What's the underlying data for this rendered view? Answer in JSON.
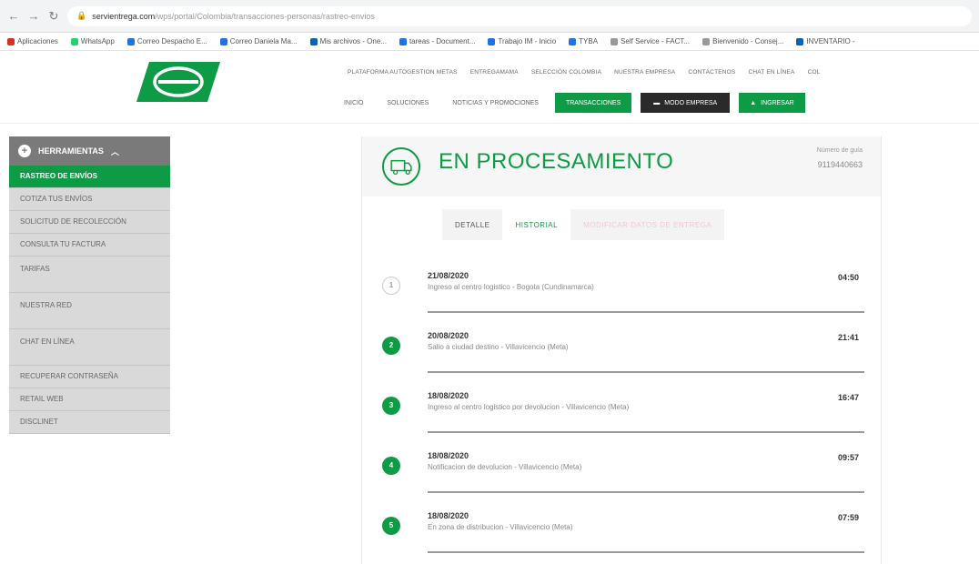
{
  "browser": {
    "url_host": "servientrega.com",
    "url_path": "/wps/portal/Colombia/transacciones-personas/rastreo-envios",
    "bookmarks": [
      {
        "label": "Aplicaciones",
        "color": "#d93025"
      },
      {
        "label": "WhatsApp",
        "color": "#25d366"
      },
      {
        "label": "Correo Despacho E...",
        "color": "#1a73e8"
      },
      {
        "label": "Correo Daniela Ma...",
        "color": "#1a73e8"
      },
      {
        "label": "Mis archivos - One...",
        "color": "#0364b8"
      },
      {
        "label": "tareas - Document...",
        "color": "#1a73e8"
      },
      {
        "label": "Trabajo IM - Inicio",
        "color": "#1a73e8"
      },
      {
        "label": "TYBA",
        "color": "#1a73e8"
      },
      {
        "label": "Self Service - FACT...",
        "color": "#999999"
      },
      {
        "label": "Bienvenido - Consej...",
        "color": "#999999"
      },
      {
        "label": "INVENTARIO -",
        "color": "#0364b8"
      }
    ]
  },
  "header": {
    "top_links": [
      "PLATAFORMA AUTOGESTION METAS",
      "ENTREGAMAMA",
      "SELECCIÓN COLOMBIA",
      "NUESTRA EMPRESA",
      "CONTÁCTENOS",
      "CHAT EN LÍNEA",
      "COL"
    ],
    "main_links": [
      "INICIO",
      "SOLUCIONES",
      "NOTICIAS Y PROMOCIONES"
    ],
    "btn_transacciones": "TRANSACCIONES",
    "btn_modo_empresa": "MODO EMPRESA",
    "btn_ingresar": "INGRESAR"
  },
  "sidebar": {
    "title": "HERRAMIENTAS",
    "items": [
      {
        "label": "RASTREO DE ENVÍOS",
        "active": true
      },
      {
        "label": "COTIZA TUS ENVÍOS"
      },
      {
        "label": "SOLICITUD DE RECOLECCIÓN"
      },
      {
        "label": "CONSULTA TU FACTURA"
      },
      {
        "label": "TARIFAS"
      },
      {
        "label": "NUESTRA RED"
      },
      {
        "label": "CHAT EN LÍNEA"
      },
      {
        "label": "RECUPERAR CONTRASEÑA"
      },
      {
        "label": "RETAIL WEB"
      },
      {
        "label": "DISCLINET"
      }
    ]
  },
  "status": {
    "title": "EN PROCESAMIENTO",
    "guide_label": "Número de guía",
    "guide_number": "9119440663"
  },
  "tabs": {
    "detalle": "DETALLE",
    "historial": "HISTORIAL",
    "modificar": "MODIFICAR DATOS DE ENTREGA"
  },
  "events": [
    {
      "num": "1",
      "date": "21/08/2020",
      "desc": "Ingreso al centro logistico - Bogota (Cundinamarca)",
      "time": "04:50"
    },
    {
      "num": "2",
      "date": "20/08/2020",
      "desc": "Salio a ciudad destino - Villavicencio (Meta)",
      "time": "21:41"
    },
    {
      "num": "3",
      "date": "18/08/2020",
      "desc": "Ingreso al centro logistico por devolucion - Villavicencio (Meta)",
      "time": "16:47"
    },
    {
      "num": "4",
      "date": "18/08/2020",
      "desc": "Notificacion de devolucion - Villavicencio (Meta)",
      "time": "09:57"
    },
    {
      "num": "5",
      "date": "18/08/2020",
      "desc": "En zona de distribucion - Villavicencio (Meta)",
      "time": "07:59"
    }
  ],
  "colors": {
    "brand": "#0d9b45",
    "dark_button": "#2a2a2a",
    "sidebar_head": "#7a7a7a"
  }
}
